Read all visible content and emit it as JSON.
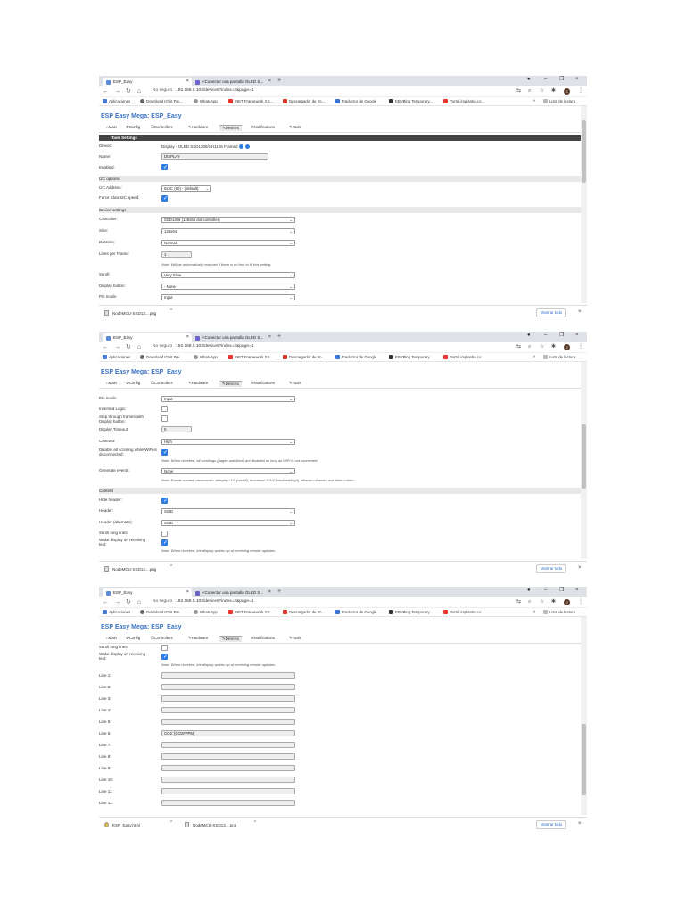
{
  "browser": {
    "tab1_title": "ESP_Easy",
    "tab2_title": "<Conectar una pantalla OLED S...",
    "url": "192.168.5.103/devices?index=2&page=1",
    "not_secure": "No seguro",
    "bookmarks": [
      "Aplicaciones",
      "Download IObit Fre...",
      "WhatsApp",
      ".NET Framework 3.5...",
      "Descargador de Yo...",
      "Traductor de Google",
      "EEVBlog Temporary...",
      "Portal.implantia.co..."
    ],
    "reading_list": "Lista de lectura",
    "avatar_letter": "J"
  },
  "app": {
    "title": "ESP Easy Mega: ESP_Easy",
    "menu": [
      "Main",
      "Config",
      "Controllers",
      "Hardware",
      "Devices",
      "Notifications",
      "Tools"
    ]
  },
  "screen1": {
    "task_settings": "Task Settings",
    "device_label": "Device:",
    "device_value": "Display - OLED SSD1306/SH1106 Framed",
    "name_label": "Name:",
    "name_value": "DISPLAY",
    "enabled_label": "Enabled:",
    "i2c_options": "I2C options",
    "i2c_address_label": "I2C Address:",
    "i2c_address_value": "0x3C (60) - (default)",
    "force_slow_label": "Force Slow I2C speed:",
    "device_settings": "Device settings",
    "controller_label": "Controller:",
    "controller_value": "SSD1306 (128x64 dot controller)",
    "size_label": "Size:",
    "size_value": "128x64",
    "rotation_label": "Rotation:",
    "rotation_value": "Normal",
    "lines_label": "Lines per Frame:",
    "lines_value": "1",
    "lines_note": "Note: Will be automatically reduced if there is no font to fit this setting.",
    "scroll_label": "Scroll:",
    "scroll_value": "Very Slow",
    "display_button_label": "Display button:",
    "display_button_value": "- None -",
    "pin_mode_label": "Pin mode:",
    "pin_mode_value": "Input"
  },
  "screen2": {
    "pin_mode_label": "Pin mode:",
    "pin_mode_value": "Input",
    "inversed_label": "Inversed Logic:",
    "step_label": "Step through frames with Display button:",
    "timeout_label": "Display Timeout:",
    "timeout_value": "0",
    "contrast_label": "Contrast:",
    "contrast_value": "High",
    "disable_scroll_label": "Disable all scrolling while WiFi is disconnected:",
    "disable_scroll_note": "Note: When checked, all scrollings (pages and lines) are disabled as long as WiFi is not connected.",
    "generate_label": "Generate events:",
    "generate_value": "None",
    "generate_note": "Note: Events named <taskname> #display=1/0 (on/off), #contrast=0/1/2 (low/med/high), #frame=<frame> and #line=<line>",
    "content": "Content",
    "hide_header_label": "Hide header:",
    "header_label": "Header:",
    "header_value": "SSID",
    "header_alt_label": "Header (alternate):",
    "header_alt_value": "SSID",
    "scroll_long_label": "Scroll long lines:",
    "wake_label": "Wake display on receiving text:",
    "wake_note": "Note: When checked, the display wakes up at receiving remote updates."
  },
  "screen3": {
    "scroll_long_label": "Scroll long lines:",
    "wake_label": "Wake display on receiving text:",
    "wake_note": "Note: When checked, the display wakes up at receiving remote updates.",
    "lines": [
      {
        "label": "Line 1:",
        "value": ""
      },
      {
        "label": "Line 2:",
        "value": ""
      },
      {
        "label": "Line 3:",
        "value": ""
      },
      {
        "label": "Line 4:",
        "value": ""
      },
      {
        "label": "Line 5:",
        "value": ""
      },
      {
        "label": "Line 6:",
        "value": "CO2: [CO2#PPM]"
      },
      {
        "label": "Line 7:",
        "value": ""
      },
      {
        "label": "Line 8:",
        "value": ""
      },
      {
        "label": "Line 9:",
        "value": ""
      },
      {
        "label": "Line 10:",
        "value": ""
      },
      {
        "label": "Line 11:",
        "value": ""
      },
      {
        "label": "Line 12:",
        "value": ""
      }
    ]
  },
  "downloads": {
    "file1": "NodeMCU-SSD13....png",
    "html_file": "ESP_Easy.html",
    "show_all": "Mostrar todo"
  },
  "colors": {
    "accent": "#3a73c5",
    "checkbox": "#2f7de1",
    "header_bar": "#444444"
  }
}
